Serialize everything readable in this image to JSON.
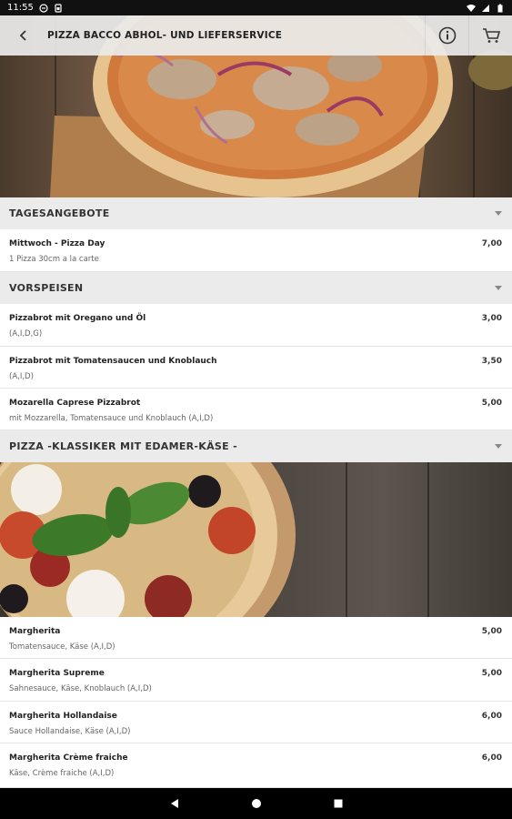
{
  "status_bar": {
    "time": "11:55"
  },
  "app_bar": {
    "title": "PIZZA BACCO ABHOL- UND LIEFERSERVICE"
  },
  "sections": [
    {
      "label": "TAGESANGEBOTE",
      "items": [
        {
          "name": "Mittwoch - Pizza Day",
          "desc": "1 Pizza 30cm a la carte",
          "price": "7,00"
        }
      ]
    },
    {
      "label": "VORSPEISEN",
      "items": [
        {
          "name": "Pizzabrot mit Oregano und Öl",
          "desc": "(A,I,D,G)",
          "price": "3,00"
        },
        {
          "name": "Pizzabrot mit Tomatensaucen und Knoblauch",
          "desc": "(A,I,D)",
          "price": "3,50"
        },
        {
          "name": "Mozarella Caprese Pizzabrot",
          "desc": "mit Mozzarella, Tomatensauce und Knoblauch (A,I,D)",
          "price": "5,00"
        }
      ]
    },
    {
      "label": "PIZZA -KLASSIKER MIT EDAMER-KÄSE -",
      "items": [
        {
          "name": "Margherita",
          "desc": "Tomatensauce, Käse (A,I,D)",
          "price": "5,00"
        },
        {
          "name": "Margherita Supreme",
          "desc": "Sahnesauce, Käse, Knoblauch (A,I,D)",
          "price": "5,00"
        },
        {
          "name": "Margherita Hollandaise",
          "desc": "Sauce Hollandaise, Käse (A,I,D)",
          "price": "6,00"
        },
        {
          "name": "Margherita Crème fraiche",
          "desc": "Käse, Crème fraiche (A,I,D)",
          "price": "6,00"
        }
      ]
    }
  ],
  "icons": {
    "back": "arrow-left-icon",
    "info": "info-icon",
    "cart": "cart-icon",
    "collapse": "chevron-down-icon",
    "nav_back": "triangle-back-icon",
    "nav_home": "circle-home-icon",
    "nav_recent": "square-recent-icon"
  },
  "colors": {
    "section_bg": "#ebebeb",
    "app_bar_bg": "#ebebeb",
    "status_bar_bg": "#111111",
    "nav_bar_bg": "#000000"
  }
}
